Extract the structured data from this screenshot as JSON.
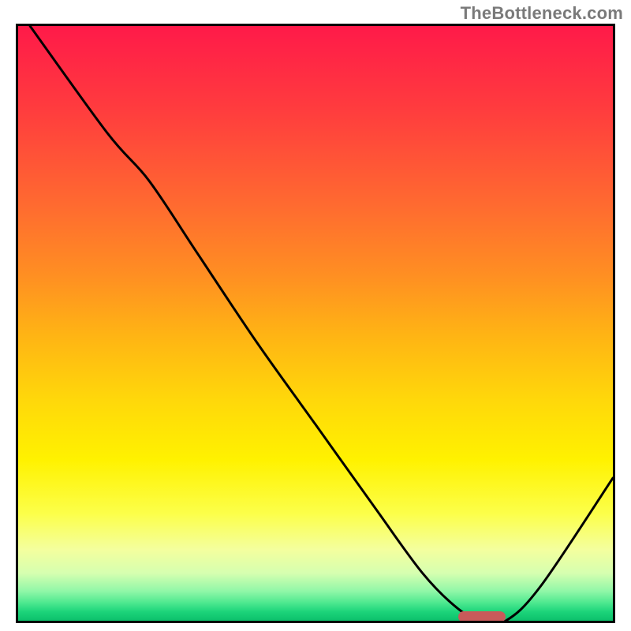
{
  "watermark": "TheBottleneck.com",
  "chart_data": {
    "type": "line",
    "title": "",
    "xlabel": "",
    "ylabel": "",
    "xlim": [
      0,
      100
    ],
    "ylim": [
      0,
      100
    ],
    "x": [
      2,
      15,
      22,
      30,
      40,
      50,
      60,
      68,
      74,
      78,
      82,
      88,
      100
    ],
    "values": [
      100,
      82,
      74,
      62,
      47,
      33,
      19,
      8,
      2,
      0,
      0,
      6,
      24
    ],
    "marker": {
      "x_start": 74,
      "x_end": 82,
      "y": 0
    },
    "gradient_stops": [
      {
        "pos": 0,
        "color": "#ff1a49"
      },
      {
        "pos": 14,
        "color": "#ff3c3e"
      },
      {
        "pos": 30,
        "color": "#ff6a30"
      },
      {
        "pos": 42,
        "color": "#ff8f22"
      },
      {
        "pos": 52,
        "color": "#ffb414"
      },
      {
        "pos": 63,
        "color": "#ffd80a"
      },
      {
        "pos": 73,
        "color": "#fff200"
      },
      {
        "pos": 82,
        "color": "#fcff4a"
      },
      {
        "pos": 88,
        "color": "#f4ff9e"
      },
      {
        "pos": 92,
        "color": "#d6ffb0"
      },
      {
        "pos": 95,
        "color": "#91f7a8"
      },
      {
        "pos": 97,
        "color": "#4de88f"
      },
      {
        "pos": 98.5,
        "color": "#1cd47a"
      },
      {
        "pos": 100,
        "color": "#0cc06b"
      }
    ]
  }
}
